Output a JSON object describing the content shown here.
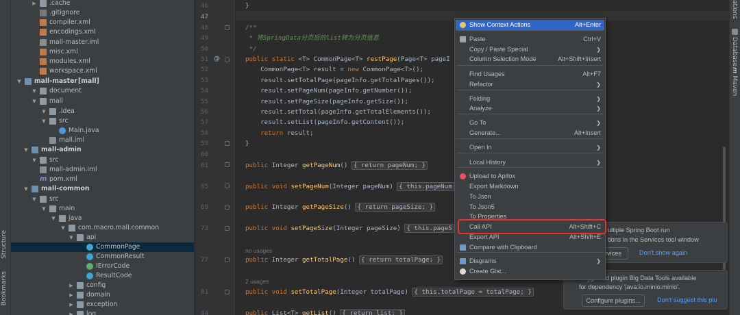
{
  "left_strip": {
    "structure": "Structure",
    "bookmarks": "Bookmarks"
  },
  "right_strip": {
    "notifications": "ations",
    "database": "Database",
    "maven": "Maven"
  },
  "project_tree": [
    {
      "label": ".cache",
      "type": "folder"
    },
    {
      "label": ".gitignore",
      "type": "git"
    },
    {
      "label": "compiler.xml",
      "type": "xml"
    },
    {
      "label": "encodings.xml",
      "type": "xml"
    },
    {
      "label": "mall-master.iml",
      "type": "iml"
    },
    {
      "label": "misc.xml",
      "type": "xml"
    },
    {
      "label": "modules.xml",
      "type": "xml"
    },
    {
      "label": "workspace.xml",
      "type": "xml"
    },
    {
      "label": "mall-master",
      "suffix": "[mall]",
      "type": "module"
    },
    {
      "label": "document",
      "type": "folder"
    },
    {
      "label": "mall",
      "type": "folder"
    },
    {
      "label": ".idea",
      "type": "folder"
    },
    {
      "label": "src",
      "type": "folder"
    },
    {
      "label": "Main.java",
      "type": "java"
    },
    {
      "label": "mall.iml",
      "type": "iml"
    },
    {
      "label": "mall-admin",
      "type": "module"
    },
    {
      "label": "src",
      "type": "folder"
    },
    {
      "label": "mall-admin.iml",
      "type": "iml"
    },
    {
      "label": "pom.xml",
      "type": "pom"
    },
    {
      "label": "mall-common",
      "type": "module"
    },
    {
      "label": "src",
      "type": "folder"
    },
    {
      "label": "main",
      "type": "folder"
    },
    {
      "label": "java",
      "type": "folder"
    },
    {
      "label": "com.macro.mall.common",
      "type": "package"
    },
    {
      "label": "api",
      "type": "package"
    },
    {
      "label": "CommonPage",
      "type": "class"
    },
    {
      "label": "CommonResult",
      "type": "class"
    },
    {
      "label": "IErrorCode",
      "type": "iface"
    },
    {
      "label": "ResultCode",
      "type": "class"
    },
    {
      "label": "config",
      "type": "package"
    },
    {
      "label": "domain",
      "type": "package"
    },
    {
      "label": "exception",
      "type": "package"
    },
    {
      "label": "log",
      "type": "package"
    }
  ],
  "line_numbers": [
    "46",
    "47",
    "48",
    "49",
    "50",
    "51",
    "52",
    "53",
    "54",
    "55",
    "56",
    "57",
    "58",
    "59",
    "60",
    "61",
    "64",
    "65",
    "68",
    "69",
    "72",
    "73",
    "76",
    "77",
    "80",
    "81",
    "84"
  ],
  "code": {
    "l46": "}",
    "l48": "/**",
    "l49_star": " * ",
    "l49_text": "将SpringData分页后的list转为分页信息",
    "l50": " */",
    "l51_a": "public static ",
    "l51_b": "<T> CommonPage<T> ",
    "l51_c": "restPage",
    "l51_d": "(Page<T> pageI",
    "l52_a": "    CommonPage<T> result = ",
    "l52_b": "new ",
    "l52_c": "CommonPage<T>();",
    "l53": "    result.setTotalPage(pageInfo.getTotalPages());",
    "l54": "    result.setPageNum(pageInfo.getNumber());",
    "l55": "    result.setPageSize(pageInfo.getSize());",
    "l56": "    result.setTotal(pageInfo.getTotalElements());",
    "l57": "    result.setList(pageInfo.getContent());",
    "l58_a": "    return ",
    "l58_b": "result;",
    "l59": "}",
    "l61_a": "public ",
    "l61_b": "Integer ",
    "l61_c": "getPageNum",
    "l61_d": "() ",
    "l61_e": "{ return pageNum; }",
    "l65_a": "public void ",
    "l65_b": "setPageNum",
    "l65_c": "(Integer pageNum) ",
    "l65_d": "{ this.pageNum",
    "l69_a": "public ",
    "l69_b": "Integer ",
    "l69_c": "getPageSize",
    "l69_d": "() ",
    "l69_e": "{ return pageSize; }",
    "l73_a": "public void ",
    "l73_b": "setPageSize",
    "l73_c": "(Integer pageSize) ",
    "l73_d": "{ this.pageS",
    "hint_no_usages": "no usages",
    "l77_a": "public ",
    "l77_b": "Integer ",
    "l77_c": "getTotalPage",
    "l77_d": "() ",
    "l77_e": "{ return totalPage; }",
    "hint_2_usages": "2 usages",
    "l81_a": "public void ",
    "l81_b": "setTotalPage",
    "l81_c": "(Integer totalPage) ",
    "l81_d": "{ this.totalPage = totalPage; }",
    "l84_a": "public ",
    "l84_b": "List<T> ",
    "l84_c": "getList",
    "l84_d": "() ",
    "l84_e": "{ return list; }"
  },
  "gutter_annotation": "@",
  "context_menu": [
    {
      "label": "Show Context Actions",
      "shortcut": "Alt+Enter",
      "highlighted": true,
      "icon": "bulb-icon"
    },
    {
      "label": "Paste",
      "shortcut": "Ctrl+V",
      "icon": "paste-icon"
    },
    {
      "label": "Copy / Paste Special",
      "submenu": true
    },
    {
      "label": "Column Selection Mode",
      "shortcut": "Alt+Shift+Insert"
    },
    {
      "label": "Find Usages",
      "shortcut": "Alt+F7"
    },
    {
      "label": "Refactor",
      "submenu": true
    },
    {
      "label": "Folding",
      "submenu": true
    },
    {
      "label": "Analyze",
      "submenu": true
    },
    {
      "label": "Go To",
      "submenu": true
    },
    {
      "label": "Generate...",
      "shortcut": "Alt+Insert"
    },
    {
      "label": "Open In",
      "submenu": true
    },
    {
      "label": "Local History",
      "submenu": true
    },
    {
      "label": "Upload to Apifox",
      "icon": "apifox-icon"
    },
    {
      "label": "Export Markdown"
    },
    {
      "label": "To Json"
    },
    {
      "label": "To Json5"
    },
    {
      "label": "To Properties"
    },
    {
      "label": "Call API",
      "shortcut": "Alt+Shift+C"
    },
    {
      "label": "Export API",
      "shortcut": "Alt+Shift+E"
    },
    {
      "label": "Compare with Clipboard",
      "icon": "compare-icon"
    },
    {
      "label": "Diagrams",
      "submenu": true,
      "icon": "diagram-icon"
    },
    {
      "label": "Create Gist...",
      "icon": "github-icon"
    }
  ],
  "notification_1": {
    "line1": "ultiple Spring Boot run",
    "line2": "tions in the Services tool window",
    "button": "rvices",
    "link": "Don't show again"
  },
  "notification_2": {
    "line1": "Suggested plugin Big Data Tools available",
    "line2": "for dependency 'java:io.minio:minio'.",
    "button": "Configure plugins...",
    "link": "Don't suggest this plu"
  },
  "colors": {
    "menu_highlight": "#2f65ca",
    "call_api_outline": "#e3342f",
    "link": "#589df6"
  }
}
